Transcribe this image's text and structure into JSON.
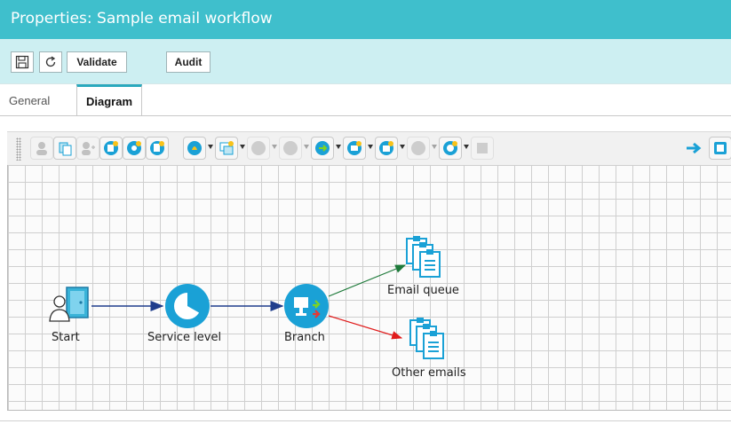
{
  "window": {
    "title": "Properties: Sample email workflow"
  },
  "toolbar": {
    "save_icon": "floppy-disk-icon",
    "refresh_icon": "refresh-icon",
    "validate_label": "Validate",
    "audit_label": "Audit"
  },
  "tabs": [
    {
      "label": "General",
      "active": false
    },
    {
      "label": "Diagram",
      "active": true
    }
  ],
  "diagram_toolbar": {
    "icons": [
      "agent-icon",
      "copy-queue-icon",
      "add-user-icon",
      "queue-star-icon",
      "route-star-icon",
      "queue-edit-icon",
      "alarm-star-icon",
      "branch-star-icon",
      "disabled-icon",
      "disabled-icon-2",
      "switch-star-icon",
      "email-star-icon",
      "email-star-icon-2",
      "disabled-icon-3",
      "clock-star-icon",
      "disabled-icon-4",
      "arrow-right-icon",
      "window-icon"
    ]
  },
  "diagram": {
    "nodes": [
      {
        "id": "start",
        "label": "Start",
        "icon": "start-door-user-icon"
      },
      {
        "id": "service",
        "label": "Service level",
        "icon": "service-level-pie-icon"
      },
      {
        "id": "branch",
        "label": "Branch",
        "icon": "branch-icon"
      },
      {
        "id": "emailq",
        "label": "Email queue",
        "icon": "queue-clipboard-icon"
      },
      {
        "id": "other",
        "label": "Other emails",
        "icon": "queue-clipboard-icon"
      }
    ],
    "colors": {
      "flow": "#1f3d8c",
      "branch_true": "#1e7a3a",
      "branch_false": "#e01b1b",
      "node_blue": "#1aa1d6"
    }
  }
}
